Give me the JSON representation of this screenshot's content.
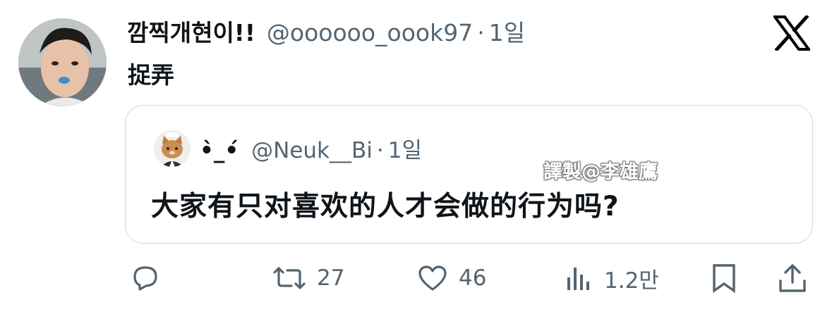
{
  "tweet": {
    "display_name": "깜찍개현이!!",
    "handle": "@oooooo_oook97",
    "separator": "·",
    "time": "1일",
    "text": "捉弄"
  },
  "quoted_tweet": {
    "display_name": "•̀_•́",
    "handle": "@Neuk__Bi",
    "separator": "·",
    "time": "1일",
    "text": "大家有只对喜欢的人才会做的行为吗?"
  },
  "watermark": "譯製@李雄鷹",
  "actions": {
    "reply_icon": "reply-icon",
    "retweet_icon": "retweet-icon",
    "retweet_count": "27",
    "like_icon": "heart-icon",
    "like_count": "46",
    "views_icon": "views-icon",
    "views_count": "1.2만",
    "bookmark_icon": "bookmark-icon",
    "share_icon": "share-icon"
  },
  "brand_logo": "x-logo",
  "colors": {
    "text": "#0f1419",
    "secondary": "#536471",
    "border": "#cfd9de"
  }
}
